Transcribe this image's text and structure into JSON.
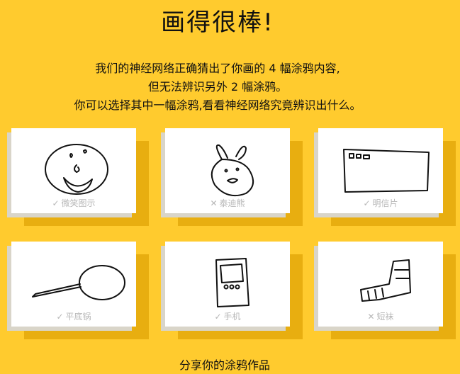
{
  "title": "画得很棒!",
  "description": {
    "line1": "我们的神经网络正确猜出了你画的 4 幅涂鸦内容,",
    "line2": "但无法辨识另外 2 幅涂鸦。",
    "line3": "你可以选择其中一幅涂鸦,看看神经网络究竟辨识出什么。"
  },
  "drawings": [
    {
      "label": "微笑图示",
      "mark": "✓",
      "recognized": true,
      "icon": "smiley-drawing"
    },
    {
      "label": "泰迪熊",
      "mark": "✕",
      "recognized": false,
      "icon": "teddy-bear-drawing"
    },
    {
      "label": "明信片",
      "mark": "✓",
      "recognized": true,
      "icon": "postcard-drawing"
    },
    {
      "label": "平底锅",
      "mark": "✓",
      "recognized": true,
      "icon": "frying-pan-drawing"
    },
    {
      "label": "手机",
      "mark": "✓",
      "recognized": true,
      "icon": "cellphone-drawing"
    },
    {
      "label": "短袜",
      "mark": "✕",
      "recognized": false,
      "icon": "sock-drawing"
    }
  ],
  "share_label": "分享你的涂鸦作品"
}
